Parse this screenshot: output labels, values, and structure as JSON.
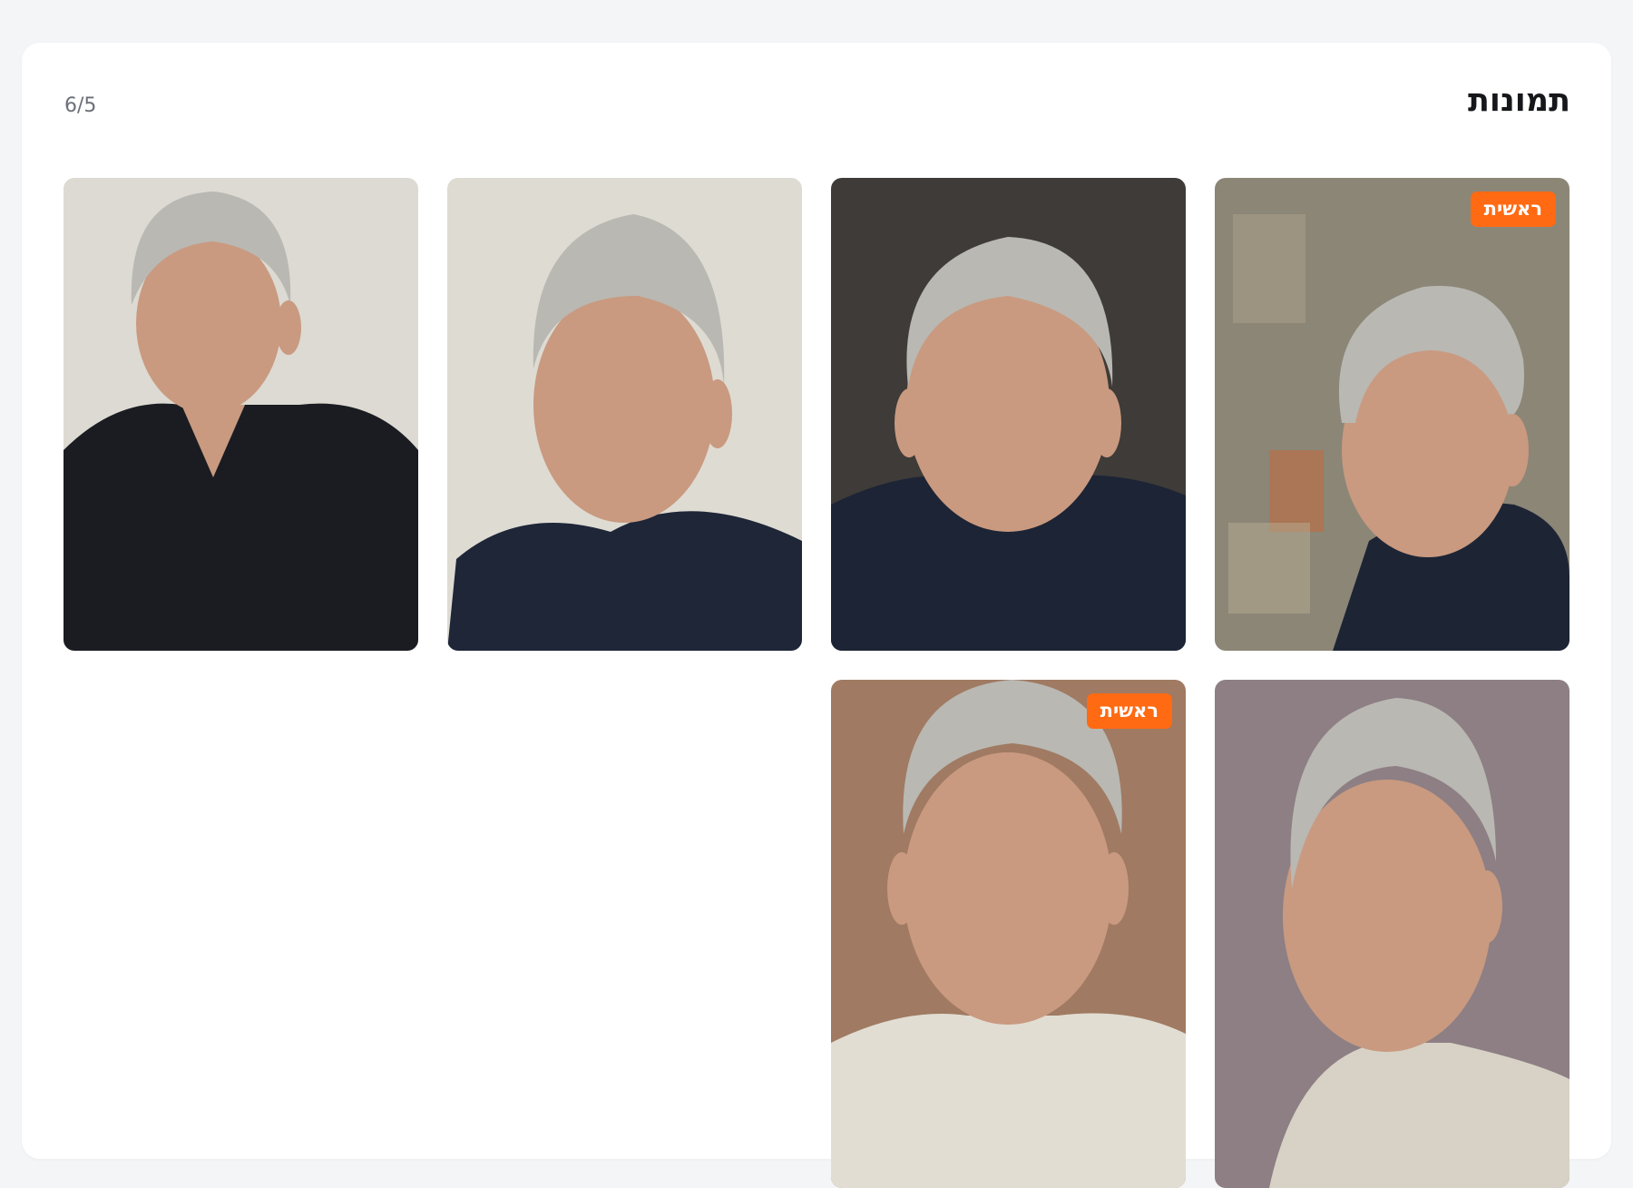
{
  "gallery": {
    "title": "תמונות",
    "counter": "6/5",
    "photos": [
      {
        "alt": "headshot-outdoor-side-glance",
        "primary": true,
        "badge": "ראשית",
        "bg": "#8c8677",
        "shirt": "#1d2535"
      },
      {
        "alt": "headshot-dark-background",
        "primary": false,
        "bg": "#3e3b38",
        "shirt": "#1c2435"
      },
      {
        "alt": "headshot-light-background-tshirt",
        "primary": false,
        "bg": "#dedbd3",
        "shirt": "#1e2638"
      },
      {
        "alt": "headshot-smiling-black-shirt",
        "primary": false,
        "bg": "#dcdad2",
        "shirt": "#1a1c22"
      },
      {
        "alt": "headshot-mauve-background",
        "primary": false,
        "bg": "#8d7f84",
        "shirt": "#d7d2c5"
      },
      {
        "alt": "headshot-brown-background",
        "primary": true,
        "badge": "ראשית",
        "bg": "#a07a62",
        "shirt": "#e1ddd2"
      }
    ]
  },
  "colors": {
    "accent": "#ff6a13",
    "page_bg": "#f4f5f7",
    "card_bg": "#ffffff",
    "hair": "#b9b8b3",
    "skin": "#c99a80"
  }
}
